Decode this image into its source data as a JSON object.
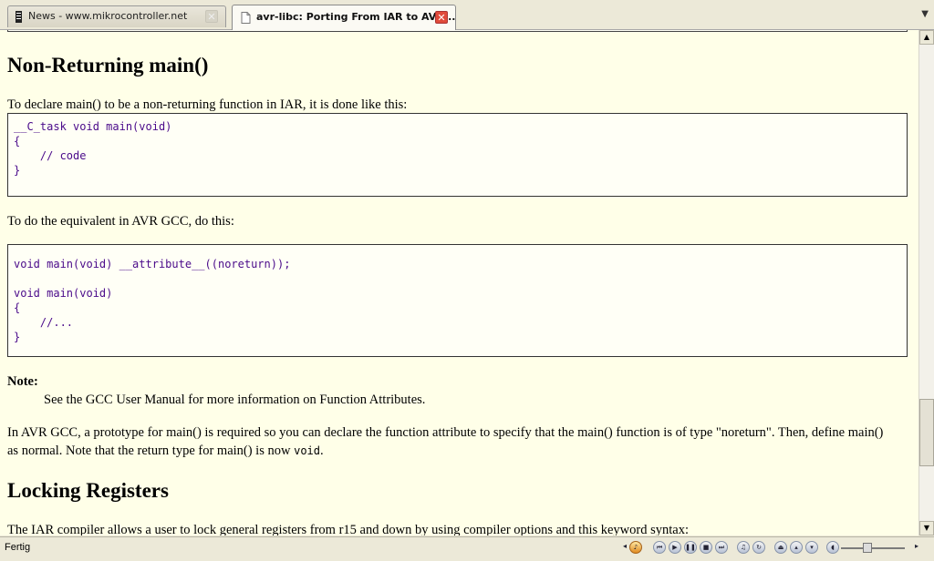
{
  "tabs": [
    {
      "label": "News - www.mikrocontroller.net",
      "active": false
    },
    {
      "label": "avr-libc: Porting From IAR to AVR...",
      "active": true
    }
  ],
  "content": {
    "heading1": "Non-Returning main()",
    "p1": "To declare main() to be a non-returning function in IAR, it is done like this:",
    "code1": [
      "__C_task void main(void)",
      "{",
      "    // code",
      "}"
    ],
    "p2": "To do the equivalent in AVR GCC, do this:",
    "code2": [
      "void main(void) __attribute__((noreturn));",
      "",
      "void main(void)",
      "{",
      "    //...",
      "}"
    ],
    "note_label": "Note:",
    "note_text": "See the GCC User Manual for more information on Function Attributes.",
    "p3_line1": "In AVR GCC, a prototype for main() is required so you can declare the function attribute to specify that the main() function is of type \"noreturn\". Then, define main()",
    "p3_line2": "as normal. Note that the return type for main() is now",
    "p3_code": "void",
    "p3_end": ".",
    "heading2": "Locking Registers",
    "p4": "The IAR compiler allows a user to lock general registers from r15 and down by using compiler options and this keyword syntax:"
  },
  "status": {
    "text": "Fertig"
  },
  "colors": {
    "page_bg": "#ffffe8",
    "code_text": "#4a0a8a"
  }
}
